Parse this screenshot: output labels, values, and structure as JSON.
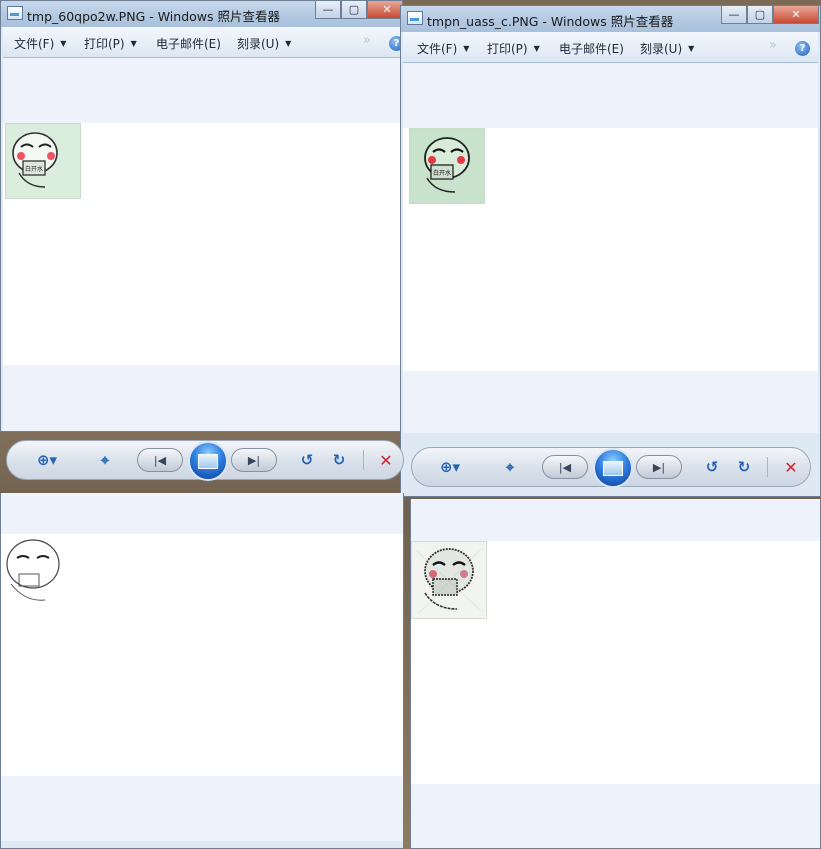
{
  "windows": [
    {
      "id": "w1",
      "title": "tmp_60qpo2w.PNG - Windows 照片查看器",
      "menu": {
        "file": "文件(F)",
        "print": "打印(P)",
        "email": "电子邮件(E)",
        "burn": "刻录(U)"
      },
      "help": "?",
      "thumb_caption": "白开水"
    },
    {
      "id": "w2",
      "title": "tmpn_uass_c.PNG - Windows 照片查看器",
      "menu": {
        "file": "文件(F)",
        "print": "打印(P)",
        "email": "电子邮件(E)",
        "burn": "刻录(U)"
      },
      "help": "?",
      "thumb_caption": "白开水"
    }
  ],
  "toolbar": {
    "zoom_icon": "zoom-icon",
    "fit_icon": "actual-size-icon",
    "prev_icon": "previous-icon",
    "slideshow_icon": "slideshow-icon",
    "next_icon": "next-icon",
    "rotate_ccw_icon": "rotate-counterclockwise-icon",
    "rotate_cw_icon": "rotate-clockwise-icon",
    "delete_icon": "delete-icon",
    "colors": {
      "accent": "#2563b5",
      "delete": "#d0242f"
    }
  }
}
